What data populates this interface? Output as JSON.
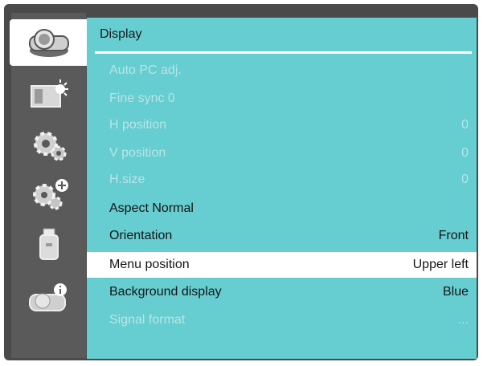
{
  "menu": {
    "title": "Display",
    "items": [
      {
        "label": "Auto PC adj.",
        "value": "",
        "state": "disabled"
      },
      {
        "label": "Fine sync 0",
        "value": "",
        "state": "disabled"
      },
      {
        "label": "H position",
        "value": "0",
        "state": "disabled"
      },
      {
        "label": "V position",
        "value": "0",
        "state": "disabled"
      },
      {
        "label": "H.size",
        "value": "0",
        "state": "disabled"
      },
      {
        "label": "Aspect Normal",
        "value": "",
        "state": "enabled"
      },
      {
        "label": "Orientation",
        "value": "Front",
        "state": "enabled"
      },
      {
        "label": "Menu position",
        "value": "Upper left",
        "state": "selected"
      },
      {
        "label": "Background display",
        "value": "Blue",
        "state": "enabled"
      },
      {
        "label": "Signal format",
        "value": "...",
        "state": "disabled"
      }
    ]
  },
  "sidebar": {
    "items": [
      {
        "icon": "projector-icon",
        "active": true
      },
      {
        "icon": "picture-icon",
        "active": false
      },
      {
        "icon": "settings-icon",
        "active": false
      },
      {
        "icon": "expanded-settings-icon",
        "active": false
      },
      {
        "icon": "usb-icon",
        "active": false
      },
      {
        "icon": "info-icon",
        "active": false
      }
    ]
  },
  "colors": {
    "panel": "#66cdd0",
    "frame": "#4a4a4a",
    "sidebar": "#5a5a5a",
    "highlight": "#ffffff",
    "disabled_text": "#b9e5e7"
  }
}
